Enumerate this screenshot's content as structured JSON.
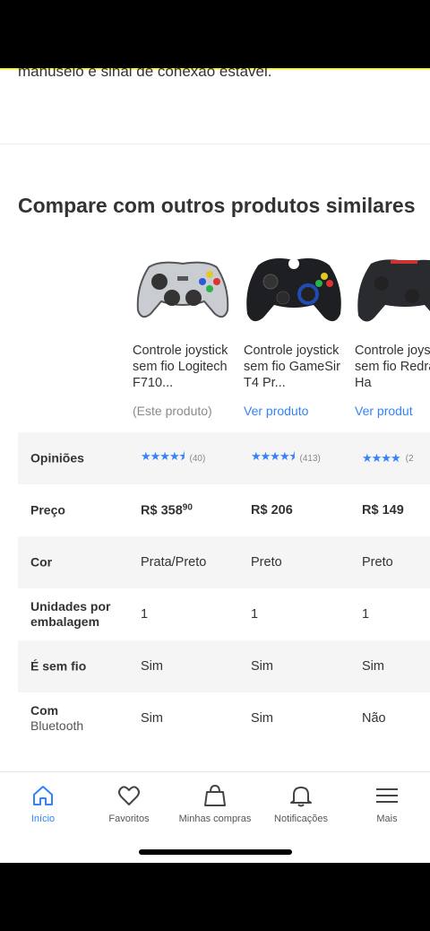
{
  "previous_text": "manuseio e sinal de conexão estável.",
  "section_title": "Compare com outros produtos similares",
  "products": [
    {
      "name": "Controle joystick sem fio Logitech F710...",
      "link": "(Este produto)"
    },
    {
      "name": "Controle joystick sem fio GameSir T4 Pr...",
      "link": "Ver produto"
    },
    {
      "name": "Controle joystick sem fio Redragon Ha",
      "link": "Ver produt"
    }
  ],
  "rows": {
    "opinions": {
      "label": "Opiniões",
      "values": [
        {
          "rating": 4.5,
          "count": "(40)"
        },
        {
          "rating": 4.5,
          "count": "(413)"
        },
        {
          "rating": 4,
          "count": "(2"
        }
      ]
    },
    "price": {
      "label": "Preço",
      "values": [
        {
          "main": "R$ 358",
          "cents": "90"
        },
        {
          "main": "R$ 206",
          "cents": ""
        },
        {
          "main": "R$ 149",
          "cents": ""
        }
      ]
    },
    "color": {
      "label": "Cor",
      "values": [
        "Prata/Preto",
        "Preto",
        "Preto"
      ]
    },
    "units": {
      "label": "Unidades por embalagem",
      "values": [
        "1",
        "1",
        "1"
      ]
    },
    "wireless": {
      "label": "É sem fio",
      "values": [
        "Sim",
        "Sim",
        "Sim"
      ]
    },
    "bluetooth": {
      "label_main": "Com",
      "label_sub": "Bluetooth",
      "values": [
        "Sim",
        "Sim",
        "Não"
      ]
    }
  },
  "nav": [
    {
      "label": "Início",
      "icon": "home-icon",
      "active": true
    },
    {
      "label": "Favoritos",
      "icon": "heart-icon"
    },
    {
      "label": "Minhas compras",
      "icon": "bag-icon"
    },
    {
      "label": "Notificações",
      "icon": "bell-icon"
    },
    {
      "label": "Mais",
      "icon": "menu-icon"
    }
  ],
  "colors": {
    "accent": "#3483fa",
    "brand_yellow": "#fff159"
  }
}
